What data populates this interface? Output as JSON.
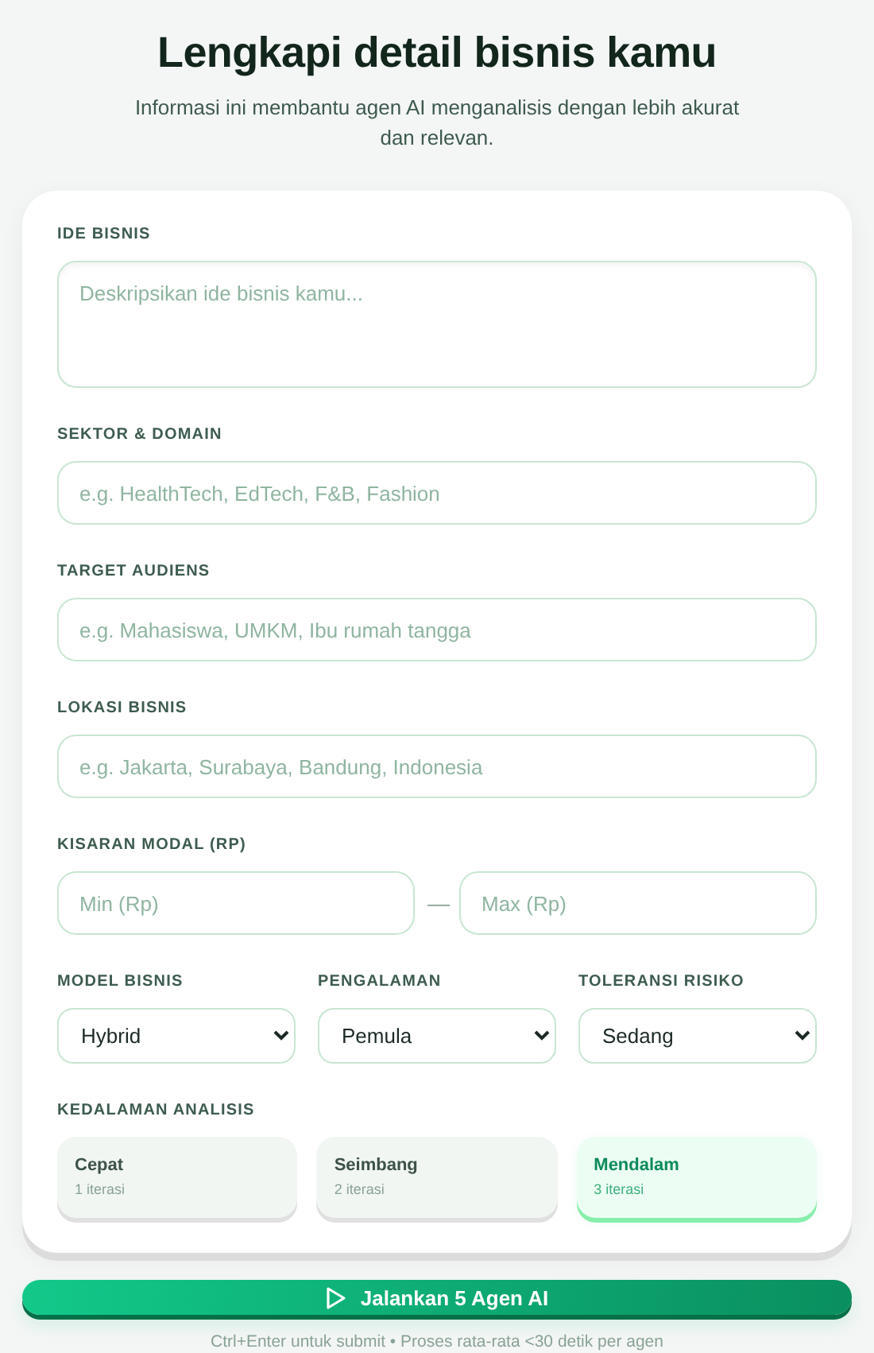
{
  "header": {
    "title": "Lengkapi detail bisnis kamu",
    "subtitle": "Informasi ini membantu agen AI menganalisis dengan lebih akurat dan relevan."
  },
  "fields": [
    {
      "kind": "textarea",
      "label": "IDE BISNIS",
      "placeholder": "Deskripsikan ide bisnis kamu..."
    },
    {
      "kind": "text",
      "label": "SEKTOR & DOMAIN",
      "placeholder": "e.g. HealthTech, EdTech, F&B, Fashion"
    },
    {
      "kind": "text",
      "label": "TARGET AUDIENS",
      "placeholder": "e.g. Mahasiswa, UMKM, Ibu rumah tangga"
    },
    {
      "kind": "text",
      "label": "LOKASI BISNIS",
      "placeholder": "e.g. Jakarta, Surabaya, Bandung, Indonesia"
    },
    {
      "kind": "range",
      "label": "KISARAN MODAL (RP)",
      "min_placeholder": "Min (Rp)",
      "separator": "—",
      "max_placeholder": "Max (Rp)"
    }
  ],
  "selects": [
    {
      "label": "MODEL BISNIS",
      "value": "Hybrid"
    },
    {
      "label": "PENGALAMAN",
      "value": "Pemula"
    },
    {
      "label": "TOLERANSI RISIKO",
      "value": "Sedang"
    }
  ],
  "depth": {
    "label": "KEDALAMAN ANALISIS",
    "options": [
      {
        "title": "Cepat",
        "note": "1 iterasi",
        "selected": false
      },
      {
        "title": "Seimbang",
        "note": "2 iterasi",
        "selected": false
      },
      {
        "title": "Mendalam",
        "note": "3 iterasi",
        "selected": true
      }
    ]
  },
  "submit": {
    "label": "Jalankan 5 Agen AI"
  },
  "hint": "Ctrl+Enter untuk submit • Proses rata-rata <30 detik per agen"
}
